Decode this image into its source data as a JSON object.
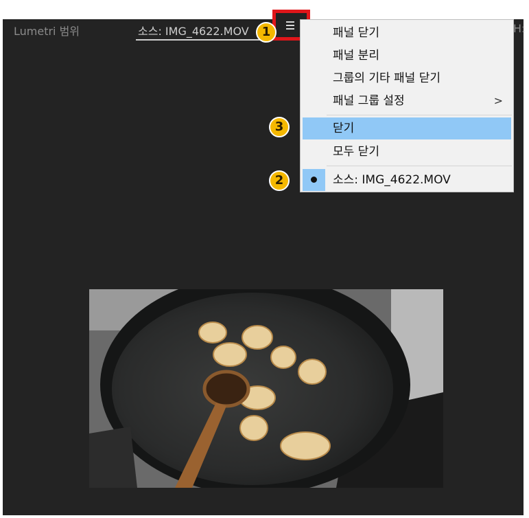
{
  "tabs": {
    "lumetri": "Lumetri 범위",
    "source": "소스: IMG_4622.MOV",
    "right_partial": "H:"
  },
  "menu_button": {
    "icon": "hamburger-menu-icon"
  },
  "menu": {
    "items": [
      {
        "label": "패널 닫기"
      },
      {
        "label": "패널 분리"
      },
      {
        "label": "그룹의 기타 패널 닫기"
      },
      {
        "label": "패널 그룹 설정",
        "submenu_arrow": ">"
      },
      {
        "label": "닫기",
        "highlighted": true
      },
      {
        "label": "모두 닫기"
      },
      {
        "label": "소스: IMG_4622.MOV",
        "checked": true
      }
    ]
  },
  "annotations": {
    "badge1": "1",
    "badge2": "2",
    "badge3": "3",
    "badge_color": "#f5b800",
    "highlight_box_color": "#e0161a"
  },
  "colors": {
    "panel_bg": "#232323",
    "menu_bg": "#f1f1f1",
    "menu_highlight": "#90c8f6"
  }
}
